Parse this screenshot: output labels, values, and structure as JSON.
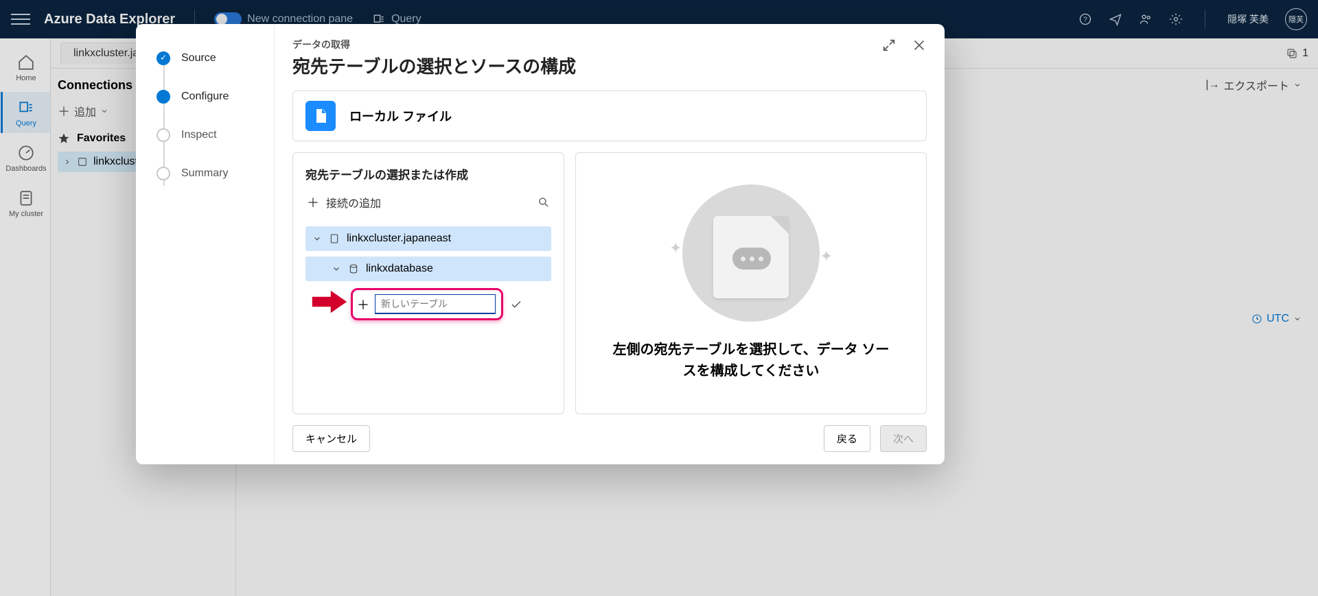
{
  "topbar": {
    "brand": "Azure Data Explorer",
    "new_conn": "New connection pane",
    "query": "Query",
    "user_name": "隠塚 芙美",
    "avatar_initials": "隠芙"
  },
  "leftrail": {
    "home": "Home",
    "query": "Query",
    "dashboards": "Dashboards",
    "mycluster": "My cluster"
  },
  "bg": {
    "tab0": "linkxcluster.jap",
    "tab_count": "1",
    "conn_title": "Connections",
    "add": "追加",
    "favorites": "Favorites",
    "cluster": "linkxclust",
    "export": "エクスポート",
    "utc": "UTC"
  },
  "modal": {
    "steps": {
      "source": "Source",
      "configure": "Configure",
      "inspect": "Inspect",
      "summary": "Summary"
    },
    "title_small": "データの取得",
    "title_large": "宛先テーブルの選択とソースの構成",
    "file_card_label": "ローカル ファイル",
    "panel_left_title": "宛先テーブルの選択または作成",
    "add_connection": "接続の追加",
    "tree": {
      "cluster": "linkxcluster.japaneast",
      "database": "linkxdatabase"
    },
    "new_table_placeholder": "新しいテーブル",
    "panel_right_text": "左側の宛先テーブルを選択して、データ ソースを構成してください",
    "footer": {
      "cancel": "キャンセル",
      "back": "戻る",
      "next": "次へ"
    }
  }
}
